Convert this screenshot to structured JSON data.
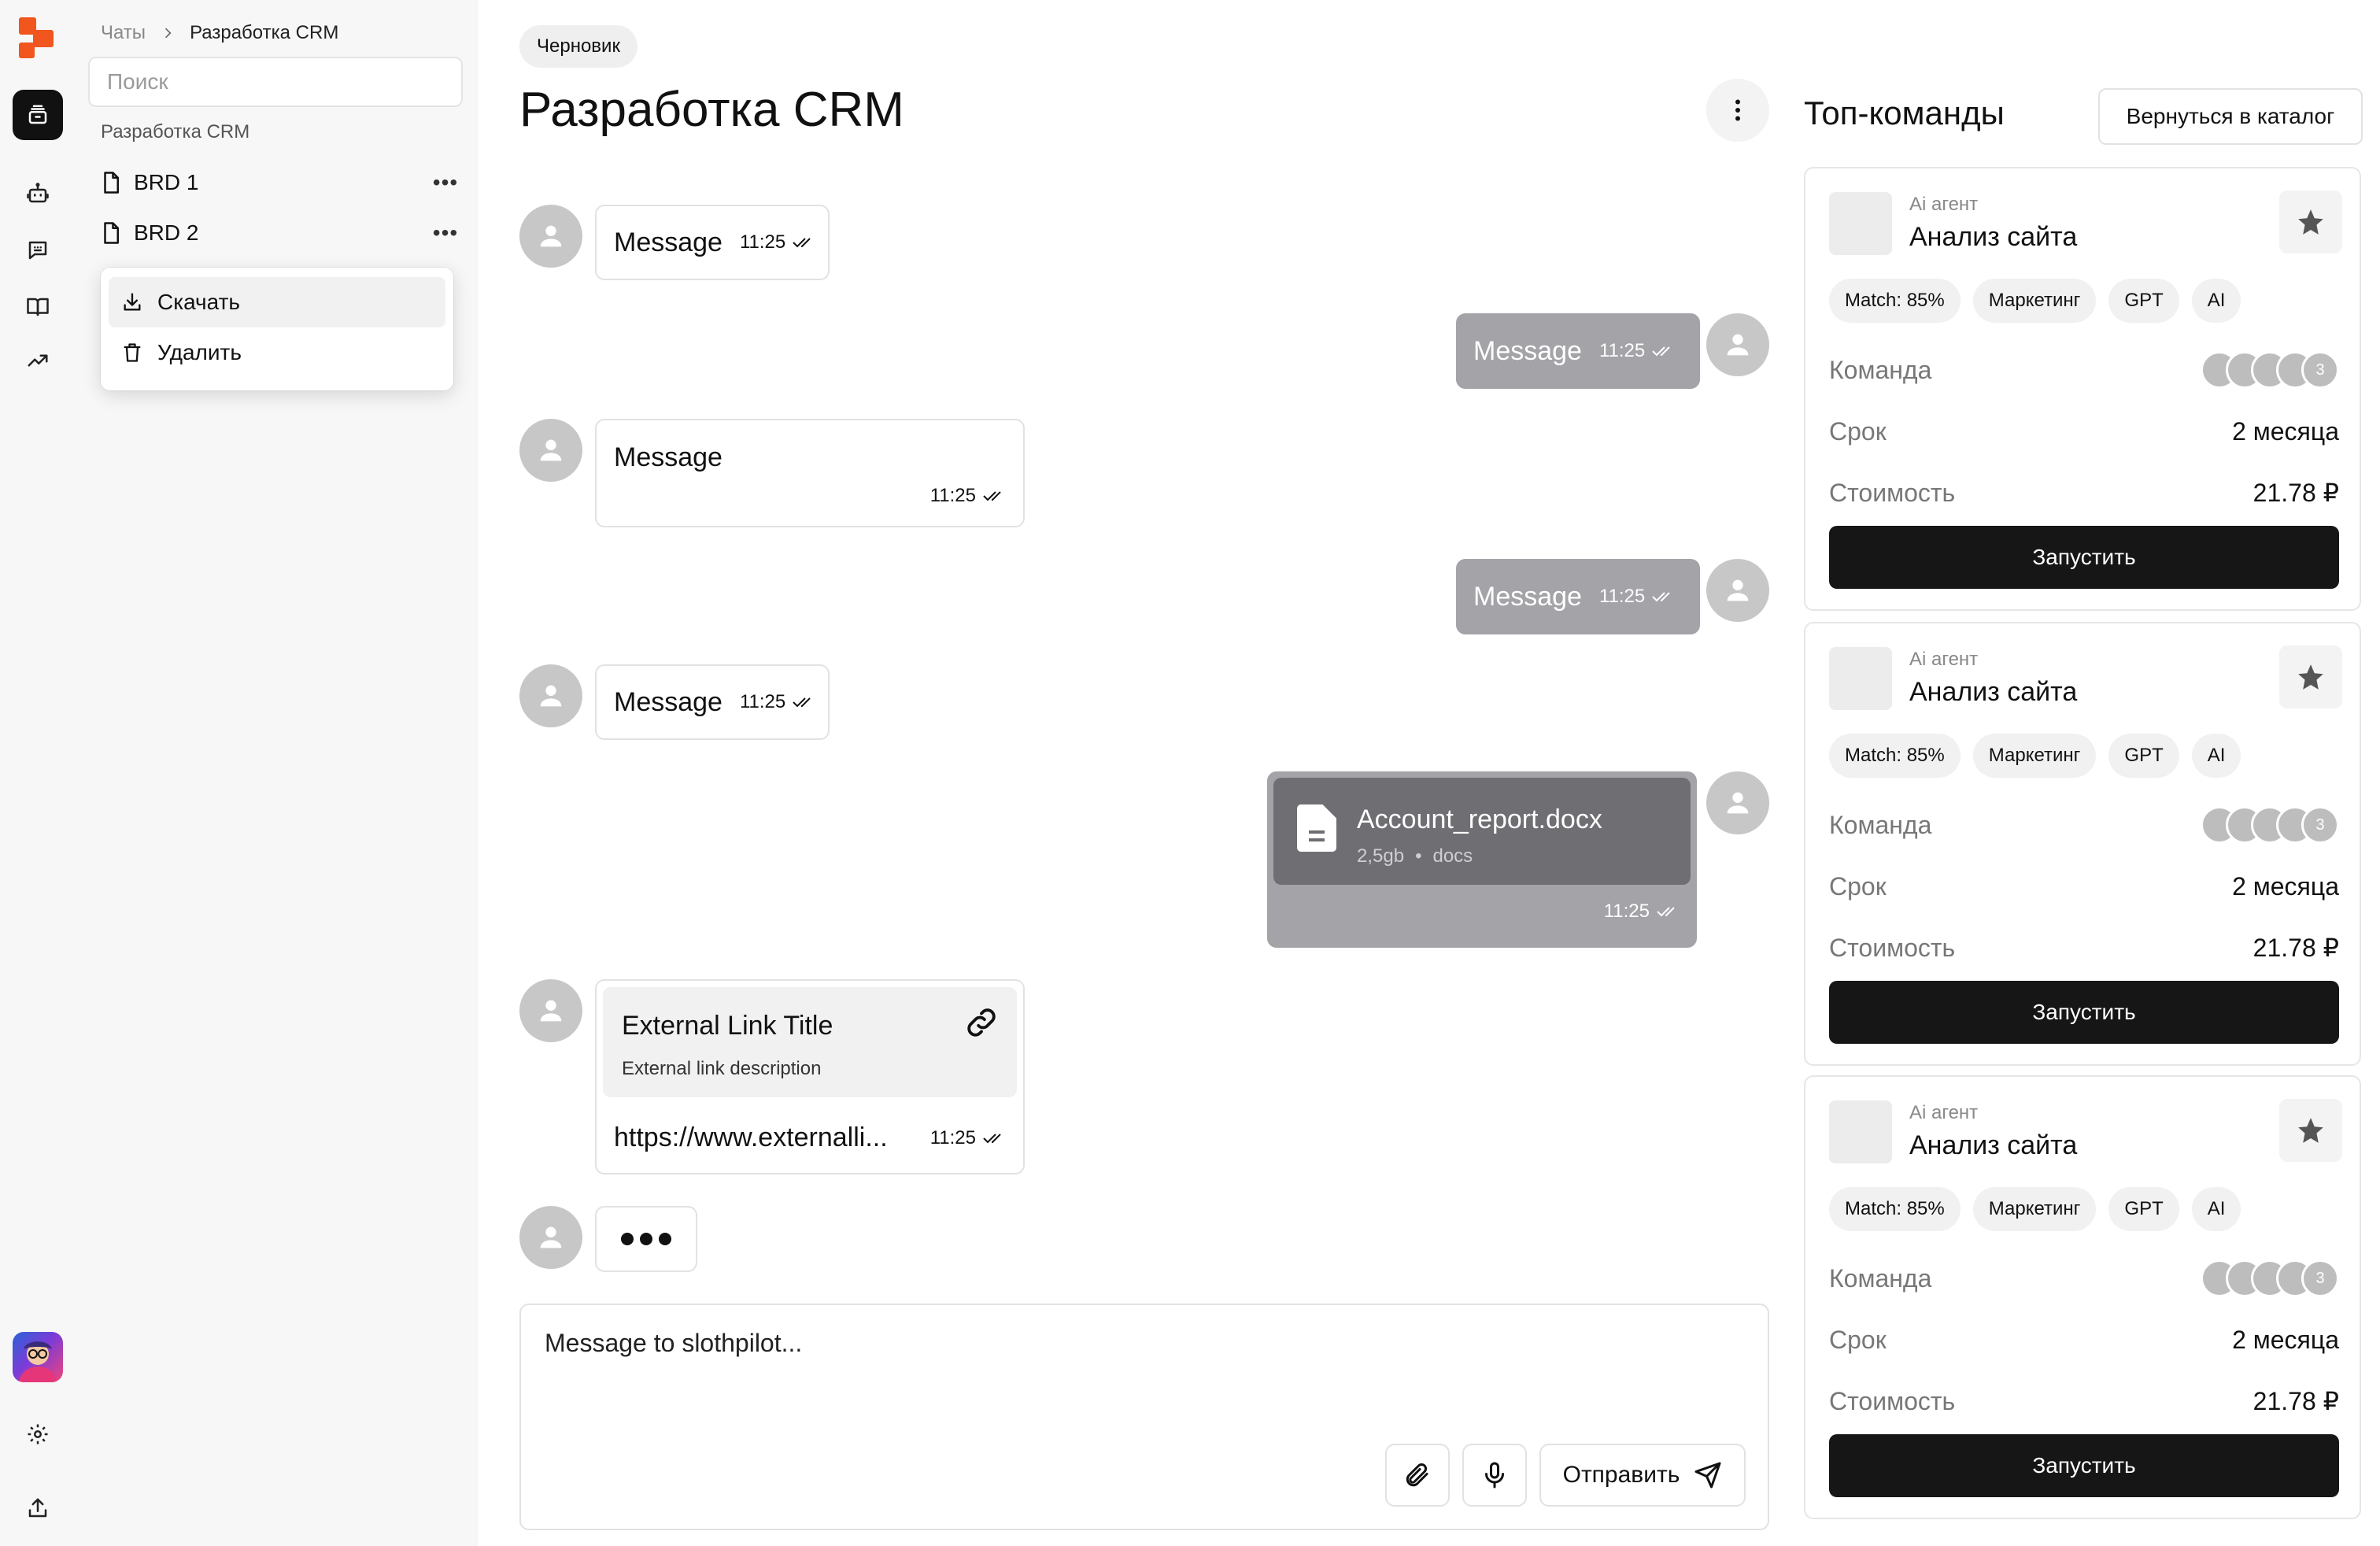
{
  "rail": {
    "items": [
      {
        "icon": "chats-stack-icon",
        "active": true
      },
      {
        "icon": "bot-icon",
        "active": false
      },
      {
        "icon": "chat-bubble-icon",
        "active": false
      },
      {
        "icon": "book-icon",
        "active": false
      },
      {
        "icon": "trend-up-icon",
        "active": false
      }
    ],
    "bottom": [
      "user-avatar",
      "gear-icon",
      "share-icon"
    ]
  },
  "sidebar": {
    "breadcrumb": {
      "root": "Чаты",
      "current": "Разработка CRM"
    },
    "search": {
      "placeholder": "Поиск"
    },
    "section_label": "Разработка CRM",
    "documents": [
      {
        "label": "BRD 1"
      },
      {
        "label": "BRD 2"
      }
    ],
    "context_menu": [
      {
        "label": "Скачать",
        "icon": "download-icon"
      },
      {
        "label": "Удалить",
        "icon": "trash-icon"
      }
    ]
  },
  "chat": {
    "badge": "Черновик",
    "title": "Разработка CRM",
    "messages": [
      {
        "from": "other",
        "text": "Message",
        "time": "11:25"
      },
      {
        "from": "me",
        "text": "Message",
        "time": "11:25"
      },
      {
        "from": "other",
        "text": "Message",
        "time": "11:25"
      },
      {
        "from": "me",
        "text": "Message",
        "time": "11:25"
      },
      {
        "from": "other",
        "text": "Message",
        "time": "11:25"
      },
      {
        "from": "me",
        "type": "file",
        "file_name": "Account_report.docx",
        "size": "2,5gb",
        "sep": "•",
        "file_type": "docs",
        "time": "11:25"
      },
      {
        "from": "other",
        "type": "link",
        "link_title": "External Link Title",
        "link_desc": "External link description",
        "url": "https://www.externalli...",
        "time": "11:25"
      }
    ],
    "composer": {
      "placeholder": "Message to slothpilot...",
      "send_label": "Отправить"
    }
  },
  "right_panel": {
    "title": "Топ-команды",
    "back_label": "Вернуться в каталог",
    "cards": [
      {
        "kind": "Ai агент",
        "name": "Анализ сайта",
        "tags": [
          "Match: 85%",
          "Маркетинг",
          "GPT",
          "AI"
        ],
        "team_label": "Команда",
        "team_extra": "3",
        "term_label": "Срок",
        "term": "2 месяца",
        "cost_label": "Стоимость",
        "cost": "21.78 ₽",
        "run_label": "Запустить"
      },
      {
        "kind": "Ai агент",
        "name": "Анализ сайта",
        "tags": [
          "Match: 85%",
          "Маркетинг",
          "GPT",
          "AI"
        ],
        "team_label": "Команда",
        "team_extra": "3",
        "term_label": "Срок",
        "term": "2 месяца",
        "cost_label": "Стоимость",
        "cost": "21.78 ₽",
        "run_label": "Запустить"
      },
      {
        "kind": "Ai агент",
        "name": "Анализ сайта",
        "tags": [
          "Match: 85%",
          "Маркетинг",
          "GPT",
          "AI"
        ],
        "team_label": "Команда",
        "team_extra": "3",
        "term_label": "Срок",
        "term": "2 месяца",
        "cost_label": "Стоимость",
        "cost": "21.78 ₽",
        "run_label": "Запустить"
      }
    ]
  },
  "colors": {
    "brand": "#f0561d",
    "outgoing_bubble": "#a3a3a8",
    "file_card": "#6e6e73",
    "primary_button": "#161616"
  }
}
